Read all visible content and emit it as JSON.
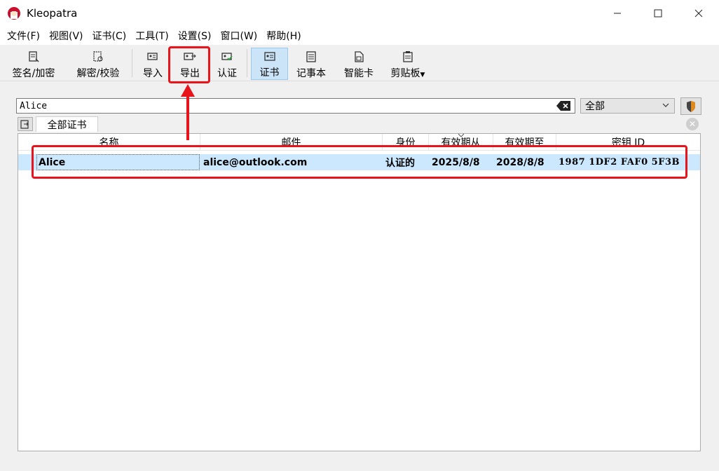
{
  "window": {
    "title": "Kleopatra",
    "controls": [
      "—",
      "☐",
      "✕"
    ]
  },
  "menu": [
    "文件(F)",
    "视图(V)",
    "证书(C)",
    "工具(T)",
    "设置(S)",
    "窗口(W)",
    "帮助(H)"
  ],
  "toolbar": {
    "sign_encrypt": "签名/加密",
    "decrypt_verify": "解密/校验",
    "import": "导入",
    "export": "导出",
    "certify": "认证",
    "certificates": "证书",
    "notepad": "记事本",
    "smartcard": "智能卡",
    "clipboard": "剪贴板"
  },
  "search": {
    "value": "Alice",
    "filter": "全部"
  },
  "tabs": {
    "all_certs": "全部证书"
  },
  "table": {
    "columns": [
      "名称",
      "邮件",
      "身份",
      "有效期从",
      "有效期至",
      "密钥 ID"
    ],
    "rows": [
      {
        "name": "Alice",
        "email": "alice@outlook.com",
        "validity": "认证的",
        "valid_from": "2025/8/8",
        "valid_until": "2028/8/8",
        "key_id": "1987 1DF2 FAF0 5F3B"
      }
    ]
  },
  "colors": {
    "highlight": "#e8141c",
    "selection": "#cce8ff",
    "active_tool": "#cce4f7"
  }
}
